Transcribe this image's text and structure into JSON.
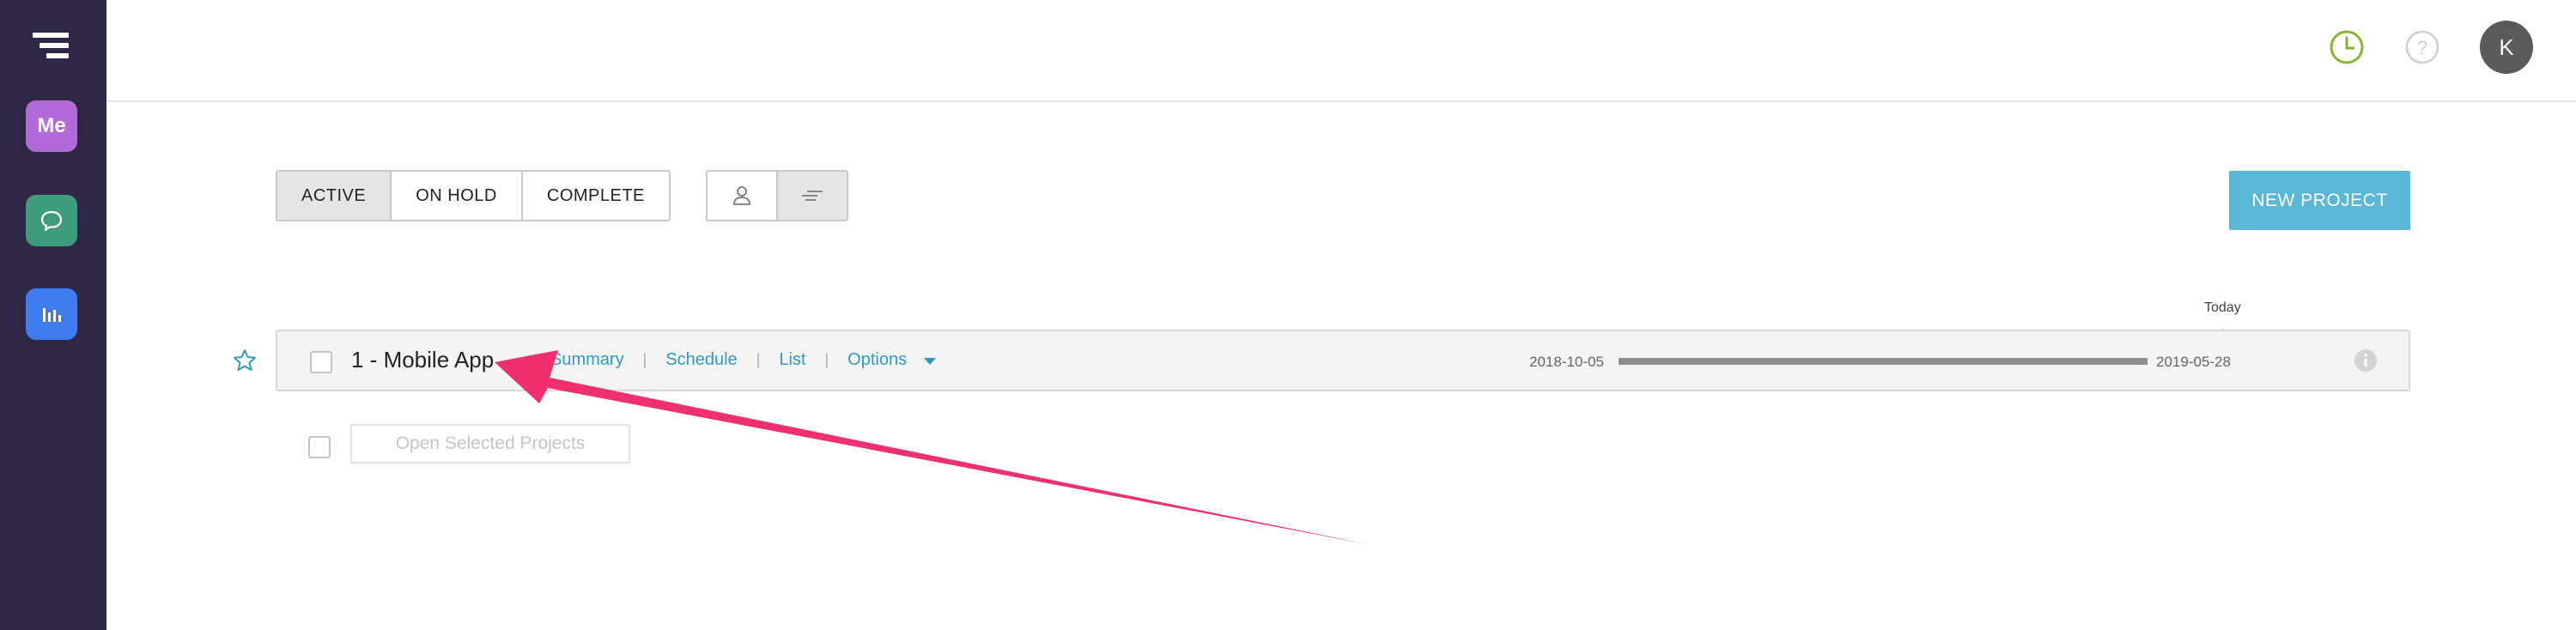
{
  "sidebar": {
    "me_label": "Me",
    "icons": [
      "menu-logo-icon",
      "chat-icon",
      "bar-chart-icon"
    ],
    "colors": {
      "background": "#2e2745",
      "me": "#b36ad9",
      "chat": "#3e9c7c",
      "reports": "#3f7cf0"
    }
  },
  "header": {
    "avatar_initial": "K",
    "icons": [
      "clock-icon",
      "help-icon"
    ],
    "clock_color": "#8ab534"
  },
  "filters": {
    "tabs": [
      {
        "label": "ACTIVE",
        "active": true
      },
      {
        "label": "ON HOLD",
        "active": false
      },
      {
        "label": "COMPLETE",
        "active": false
      }
    ],
    "view_toggle": [
      {
        "icon": "person-icon",
        "active": false
      },
      {
        "icon": "timeline-view-icon",
        "active": true
      }
    ]
  },
  "toolbar": {
    "new_project_label": "NEW PROJECT",
    "accent": "#5ab8d6"
  },
  "timeline": {
    "today_label": "Today"
  },
  "projects": [
    {
      "name": "1 - Mobile App",
      "starred": false,
      "links": [
        "Summary",
        "Schedule",
        "List",
        "Options"
      ],
      "start_date": "2018-10-05",
      "end_date": "2019-05-28",
      "progress": 1.0
    }
  ],
  "footer": {
    "open_selected_label": "Open Selected Projects"
  },
  "annotation": {
    "arrow_color": "#f0306e"
  }
}
